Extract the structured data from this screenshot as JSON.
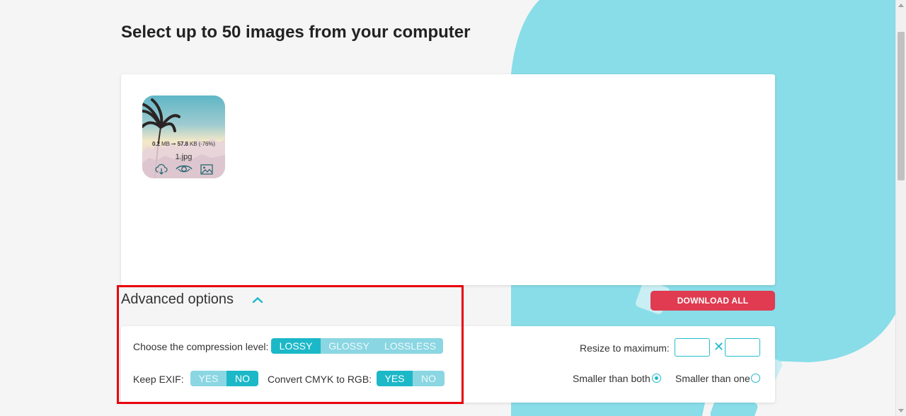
{
  "colors": {
    "background": "#f5f5f5",
    "blob": "#88dde8",
    "accent": "#1cb8c8",
    "accent_light": "#8ad6e2",
    "download": "#e03b51",
    "highlight": "#e8000c"
  },
  "page": {
    "title": "Select up to 50 images from your computer"
  },
  "files": [
    {
      "name": "1.jpg",
      "original_size": "0.2",
      "original_unit": "MB",
      "arrow": "➞",
      "compressed_size": "57.8",
      "compressed_unit": "KB",
      "savings": "(-76%)",
      "actions": [
        "cloud-download-icon",
        "eye-icon",
        "image-icon"
      ]
    }
  ],
  "advanced": {
    "label": "Advanced options",
    "expanded": true
  },
  "download_all": "DOWNLOAD ALL",
  "options": {
    "compression": {
      "label": "Choose the compression level:",
      "levels": [
        "LOSSY",
        "GLOSSY",
        "LOSSLESS"
      ],
      "selected": "LOSSY"
    },
    "exif": {
      "label": "Keep EXIF:",
      "yes": "YES",
      "no": "NO",
      "selected": "NO"
    },
    "cmyk": {
      "label": "Convert CMYK to RGB:",
      "yes": "YES",
      "no": "NO",
      "selected": "YES"
    },
    "resize": {
      "label": "Resize to maximum:",
      "separator": "✕",
      "width": "",
      "height": ""
    },
    "resize_mode": {
      "both": "Smaller than both",
      "one": "Smaller than one",
      "selected": "both"
    }
  }
}
